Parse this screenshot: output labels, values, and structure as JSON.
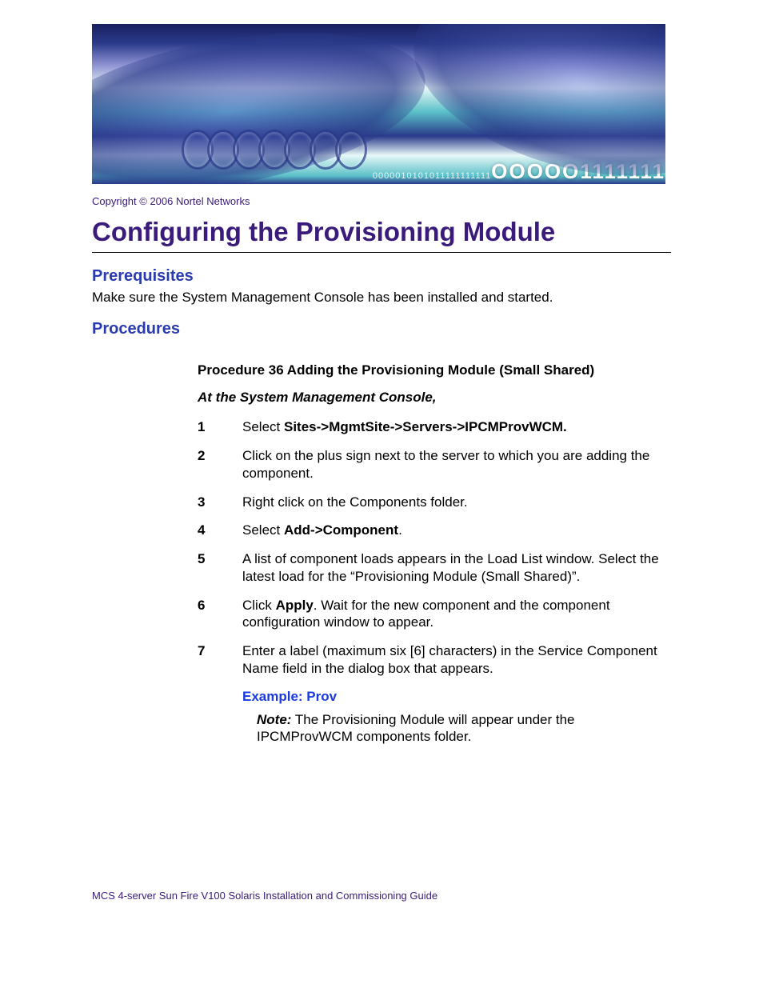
{
  "copyright": "Copyright © 2006 Nortel Networks",
  "title": "Configuring the Provisioning Module",
  "sections": {
    "prereq_heading": "Prerequisites",
    "prereq_body": "Make sure the System Management Console has been installed and started.",
    "proc_heading": "Procedures",
    "procedure_title": "Procedure 36  Adding the Provisioning Module (Small Shared)",
    "procedure_sub": "At the System Management Console,"
  },
  "steps": {
    "s1a": "Select ",
    "s1b": "Sites->MgmtSite->Servers->IPCMProvWCM.",
    "s2": "Click on the plus sign next to the server to which you are adding the component.",
    "s3": "Right click on the Components folder.",
    "s4a": "Select ",
    "s4b": "Add->Component",
    "s4c": ".",
    "s5": "A list of component loads appears in the Load List window. Select the latest load for the “Provisioning Module (Small Shared)”.",
    "s6a": "Click ",
    "s6b": "Apply",
    "s6c": ". Wait for the new component and the component configuration window to appear.",
    "s7": "Enter a label (maximum six [6] characters) in the Service Component Name field in the dialog box that appears."
  },
  "example": "Example: Prov",
  "note_label": "Note:",
  "note_body": "  The Provisioning Module will appear under the IPCMProvWCM components folder.",
  "footer": "MCS 4-server Sun Fire V100 Solaris Installation and Commissioning Guide"
}
